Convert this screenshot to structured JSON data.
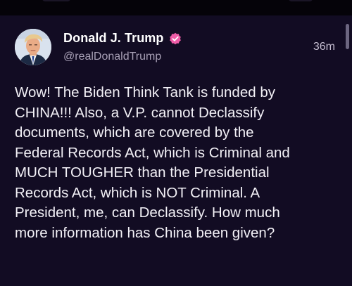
{
  "post": {
    "author": {
      "display_name": "Donald J. Trump",
      "handle": "@realDonaldTrump",
      "avatar_icon": "profile-photo",
      "verified_icon": "verified-badge-icon",
      "verified_color": "#ef5da8"
    },
    "timestamp": "36m",
    "body_lines": [
      "Wow! The Biden Think Tank is funded by",
      "CHINA!!! Also, a V.P. cannot Declassify",
      "documents, which are covered by the",
      "Federal Records Act, which is Criminal and",
      "MUCH TOUGHER than the Presidential",
      "Records Act, which is NOT Criminal. A",
      "President, me, can Declassify. How much",
      "more information has China been given?"
    ]
  },
  "theme": {
    "background": "#120c23",
    "text": "#f2f0f6",
    "muted_text": "#a79fb5"
  }
}
